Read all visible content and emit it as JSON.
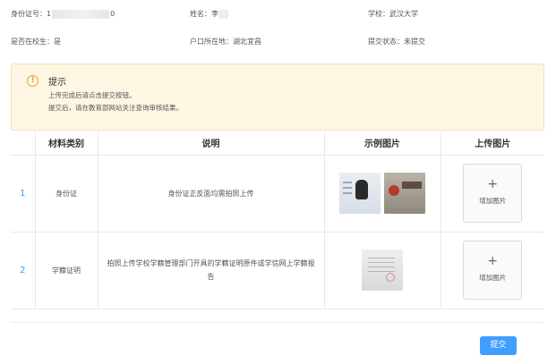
{
  "info": {
    "id_label": "身份证号：",
    "id_prefix": "1",
    "id_suffix": "0",
    "name_label": "姓名：",
    "name_value": "李",
    "school_label": "学校：",
    "school_value": "武汉大学",
    "enrolled_label": "是否在校生：",
    "enrolled_value": "是",
    "hukou_label": "户口所在地：",
    "hukou_value": "湖北宜昌",
    "status_label": "提交状态：",
    "status_value": "未提交"
  },
  "alert": {
    "icon": "warning-circle-icon",
    "icon_glyph": "!",
    "title": "提示",
    "line1": "上传完成后请点击提交按钮。",
    "line2": "提交后，请在教育部网站关注查询审核结果。"
  },
  "table": {
    "headers": [
      "",
      "材料类别",
      "说明",
      "示例图片",
      "上传图片"
    ],
    "rows": [
      {
        "index": "1",
        "category": "身份证",
        "description": "身份证正反面均需拍照上传",
        "samples": [
          "id-card-front-image",
          "id-card-back-image"
        ]
      },
      {
        "index": "2",
        "category": "学籍证明",
        "description": "拍照上传学校学籍管理部门开具的学籍证明原件或学信网上学籍报告",
        "samples": [
          "enrollment-certificate-image"
        ]
      }
    ],
    "upload": {
      "plus": "+",
      "label": "增加图片"
    }
  },
  "actions": {
    "submit_label": "提交"
  },
  "colors": {
    "primary": "#409eff",
    "warning": "#e6a23c",
    "alert_bg": "#fdf6e3"
  }
}
